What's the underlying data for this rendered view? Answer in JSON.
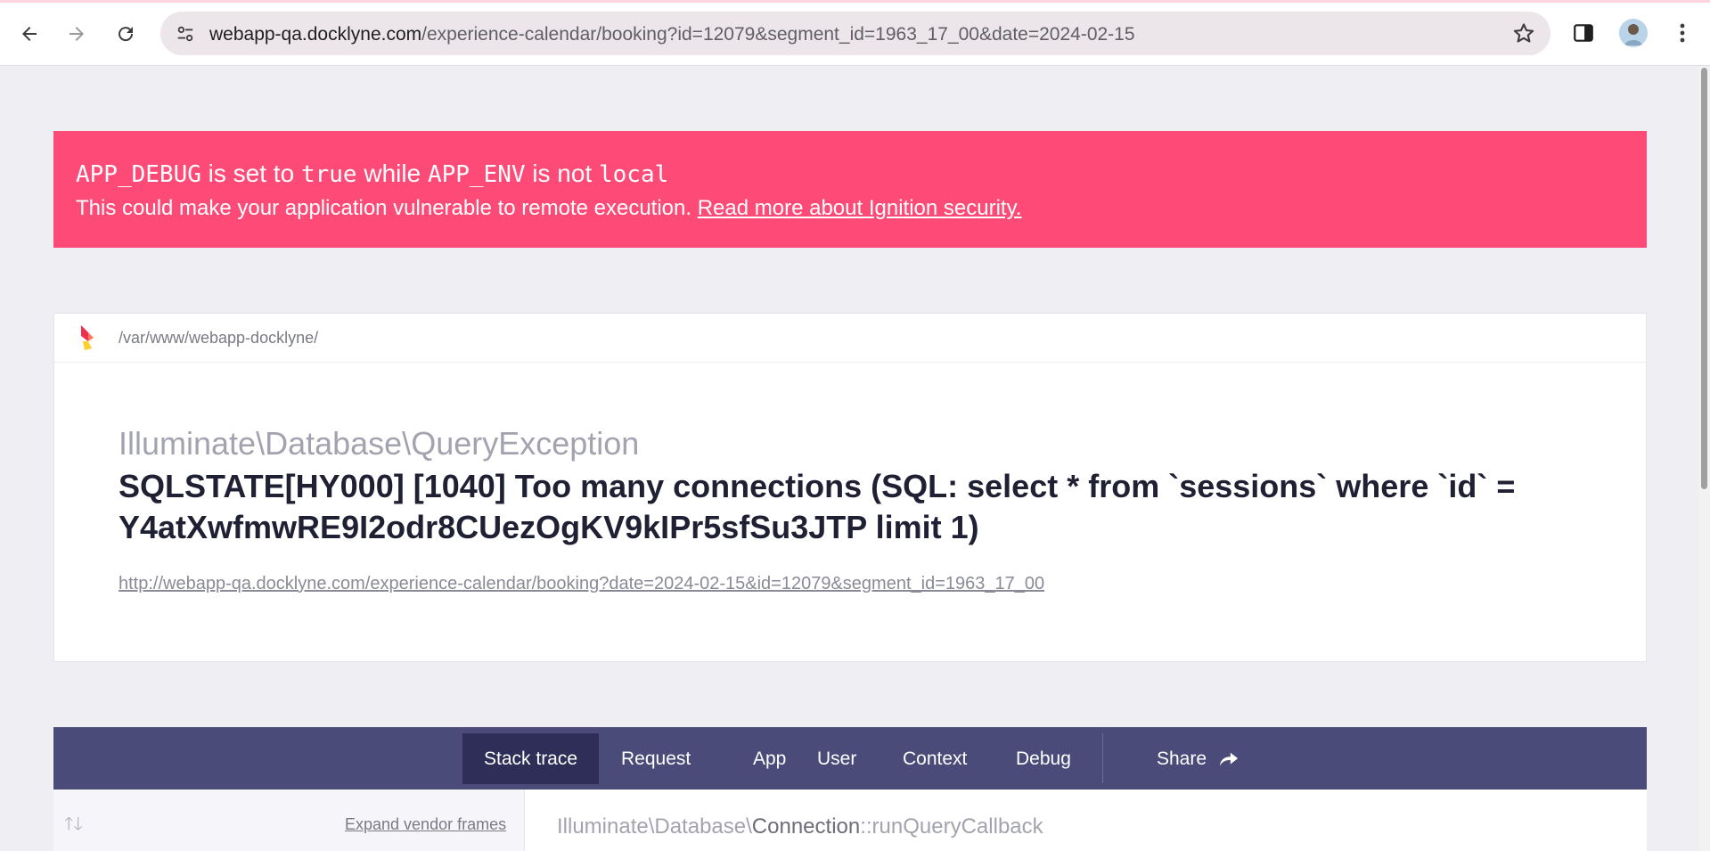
{
  "browser": {
    "url_host": "webapp-qa.docklyne.com",
    "url_path": "/experience-calendar/booking?id=12079&segment_id=1963_17_00&date=2024-02-15",
    "icons": [
      "back-arrow-icon",
      "forward-arrow-icon",
      "reload-icon",
      "site-info-icon",
      "star-icon",
      "side-panel-icon",
      "avatar",
      "menu-dots-icon"
    ]
  },
  "alert": {
    "code1": "APP_DEBUG",
    "text1": " is set to ",
    "code2": "true",
    "text2": " while ",
    "code3": "APP_ENV",
    "text3": " is not ",
    "code4": "local",
    "body": "This could make your application vulnerable to remote execution. ",
    "link": "Read more about Ignition security."
  },
  "error": {
    "path": "/var/www/webapp-docklyne/",
    "class_ns": "Illuminate\\Database\\",
    "class_name": "QueryException",
    "message": "SQLSTATE[HY000] [1040] Too many connections (SQL: select * from `sessions` where `id` = Y4atXwfmwRE9I2odr8CUezOgKV9kIPr5sfSu3JTP limit 1)",
    "url": "http://webapp-qa.docklyne.com/experience-calendar/booking?date=2024-02-15&id=12079&segment_id=1963_17_00"
  },
  "tabs": [
    {
      "label": "Stack trace",
      "active": true
    },
    {
      "label": "Request"
    },
    {
      "label": "App"
    },
    {
      "label": "User"
    },
    {
      "label": "Context"
    },
    {
      "label": "Debug"
    },
    {
      "label": "Share"
    }
  ],
  "stack": {
    "expand_label": "Expand vendor frames",
    "frame_ns": "Illuminate\\Database\\",
    "frame_class": "Connection",
    "frame_method": "::runQueryCallback"
  },
  "colors": {
    "alert_bg": "#fd4a76",
    "tabbar_bg": "#4b4b7a",
    "active_tab_bg": "#2e2e58"
  }
}
